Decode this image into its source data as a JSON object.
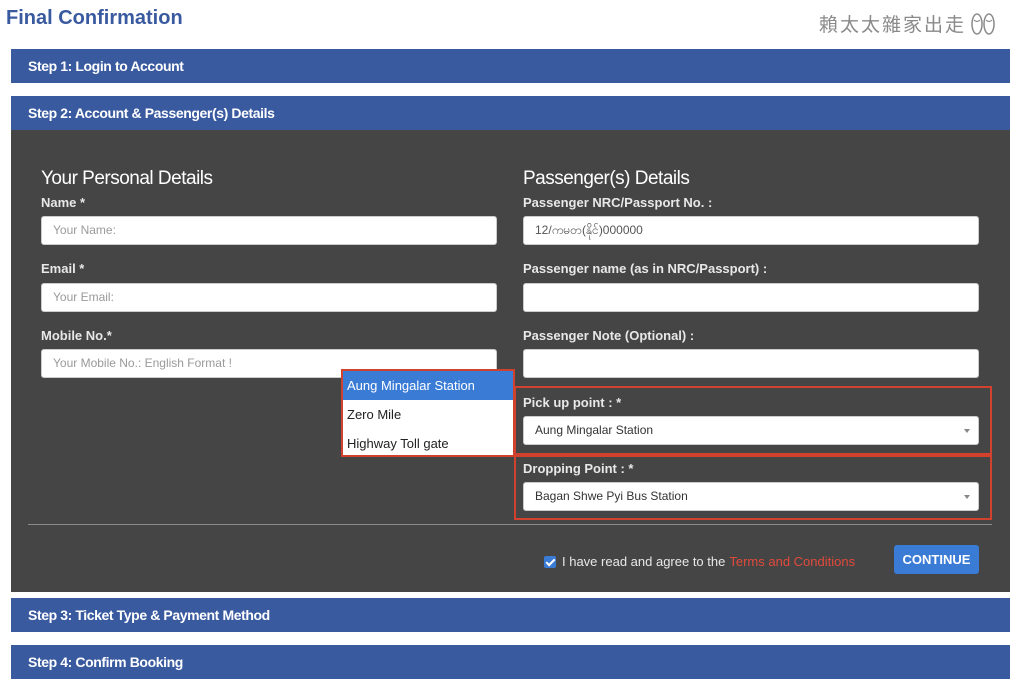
{
  "page": {
    "title": "Final Confirmation",
    "watermark": "賴太太雜家出走"
  },
  "steps": [
    {
      "label": "Step 1: Login to Account"
    },
    {
      "label": "Step 2: Account & Passenger(s) Details"
    },
    {
      "label": "Step 3: Ticket Type & Payment Method"
    },
    {
      "label": "Step 4: Confirm Booking"
    }
  ],
  "personal": {
    "heading": "Your Personal Details",
    "name_label": "Name *",
    "name_placeholder": "Your Name:",
    "email_label": "Email *",
    "email_placeholder": "Your Email:",
    "mobile_label": "Mobile No.*",
    "mobile_placeholder": "Your Mobile No.: English Format !"
  },
  "passenger": {
    "heading": "Passenger(s) Details",
    "nrc_label": "Passenger NRC/Passport No. :",
    "nrc_value": "12/ကမတ(နိုင်)000000",
    "name_label": "Passenger name (as in NRC/Passport) :",
    "name_value": "",
    "note_label": "Passenger Note (Optional) :",
    "note_value": "",
    "pickup_label": "Pick up point : *",
    "pickup_value": "Aung Mingalar Station",
    "dropping_label": "Dropping Point : *",
    "dropping_value": "Bagan Shwe Pyi Bus Station"
  },
  "pickup_dropdown": {
    "options": [
      "Aung Mingalar Station",
      "Zero Mile",
      "Highway Toll gate"
    ],
    "selected_index": 0
  },
  "footer": {
    "agree_text": "I have read and agree to the",
    "terms_link": "Terms and Conditions",
    "agree_checked": true,
    "continue_label": "CONTINUE"
  },
  "colors": {
    "step_bar": "#3a5aa0",
    "panel": "#454545",
    "highlight": "#d0412e",
    "accent": "#3a7bd5",
    "link": "#e24a3b"
  }
}
